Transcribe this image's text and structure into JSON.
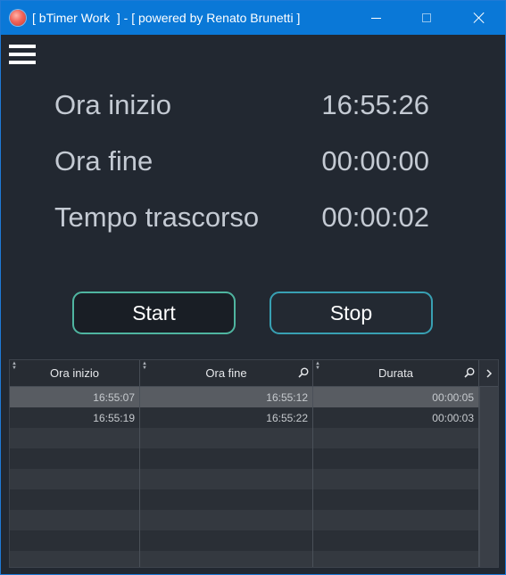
{
  "window": {
    "title": "[ bTimer Work  ] - [ powered by Renato Brunetti ]",
    "icon": "app-logo-icon",
    "controls": [
      "minimize-icon",
      "maximize-icon",
      "close-icon"
    ]
  },
  "menu": {
    "icon": "hamburger-menu-icon"
  },
  "info": {
    "start_label": "Ora inizio",
    "start_value": "16:55:26",
    "end_label": "Ora fine",
    "end_value": "00:00:00",
    "elapsed_label": "Tempo trascorso",
    "elapsed_value": "00:00:02"
  },
  "buttons": {
    "start": "Start",
    "stop": "Stop"
  },
  "grid": {
    "columns": [
      "Ora inizio",
      "Ora fine",
      "Durata"
    ],
    "rows": [
      [
        "16:55:07",
        "16:55:12",
        "00:00:05"
      ],
      [
        "16:55:19",
        "16:55:22",
        "00:00:03"
      ]
    ]
  },
  "colors": {
    "titlebar": "#0a78d7",
    "background": "#222831",
    "start_border": "#4fb5a0",
    "stop_border": "#38a0b3"
  }
}
